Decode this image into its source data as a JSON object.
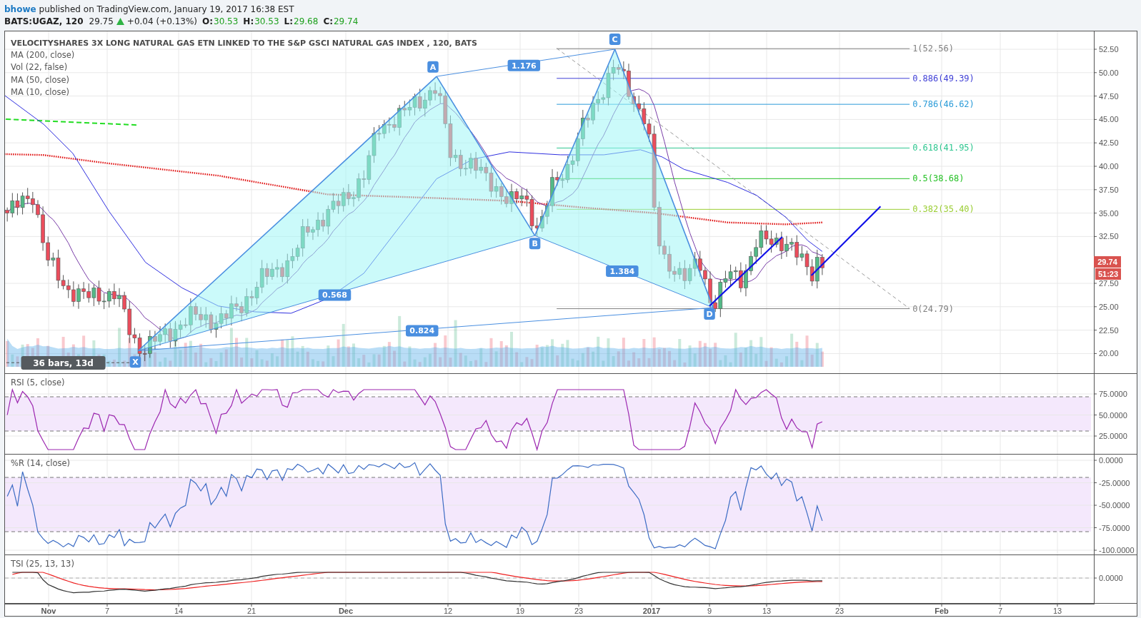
{
  "header": {
    "author": "bhowe",
    "published": "published on TradingView.com, January 19, 2017 16:38 EST"
  },
  "quote": {
    "symbol": "BATS:UGAZ, 120",
    "last": "29.75",
    "change": "+0.04 (+0.13%)",
    "ohlc": [
      {
        "label": "O:",
        "value": "30.53"
      },
      {
        "label": "H:",
        "value": "30.53"
      },
      {
        "label": "L:",
        "value": "29.68"
      },
      {
        "label": "C:",
        "value": "29.74"
      }
    ]
  },
  "price_pane": {
    "title": "VELOCITYSHARES 3X LONG NATURAL GAS ETN LINKED TO THE S&P GSCI NATURAL GAS INDEX , 120, BATS",
    "studies": [
      "MA (200, close)",
      "Vol (22, false)",
      "MA (50, close)",
      "MA (10, close)"
    ],
    "axis_labels": [
      "52.50",
      "50.00",
      "47.50",
      "45.00",
      "42.50",
      "40.00",
      "37.50",
      "35.00",
      "32.50",
      "27.50",
      "25.00",
      "22.50",
      "20.00"
    ],
    "fib_levels": [
      {
        "label": "1(52.56)",
        "color": "#808080"
      },
      {
        "label": "0.886(49.39)",
        "color": "#3f3fd6"
      },
      {
        "label": "0.786(46.62)",
        "color": "#2a9bd8"
      },
      {
        "label": "0.618(41.95)",
        "color": "#2ec68f"
      },
      {
        "label": "0.5(38.68)",
        "color": "#24c024"
      },
      {
        "label": "0.382(35.40)",
        "color": "#9acd32"
      },
      {
        "label": "0(24.79)",
        "color": "#808080"
      }
    ],
    "pattern_points": [
      "X",
      "A",
      "B",
      "C",
      "D"
    ],
    "ratios": [
      "1.176",
      "0.568",
      "1.384",
      "0.824"
    ],
    "range_label": "36 bars, 13d",
    "price_tag": "29.74",
    "countdown": "51:23"
  },
  "rsi_pane": {
    "title": "RSI (5, close)",
    "axis_labels": [
      "75.0000",
      "50.0000",
      "25.0000"
    ]
  },
  "r_pane": {
    "title": "%R (14, close)",
    "axis_labels": [
      "0.0000",
      "-25.0000",
      "-50.0000",
      "-75.0000",
      "-100.0000"
    ]
  },
  "tsi_pane": {
    "title": "TSI (25, 13, 13)",
    "axis_labels": [
      "0.0000"
    ]
  },
  "time_axis": [
    {
      "label": "Nov",
      "kind": "major"
    },
    {
      "label": "7",
      "kind": "minor"
    },
    {
      "label": "14",
      "kind": "minor"
    },
    {
      "label": "21",
      "kind": "minor"
    },
    {
      "label": "Dec",
      "kind": "major"
    },
    {
      "label": "12",
      "kind": "minor"
    },
    {
      "label": "19",
      "kind": "minor"
    },
    {
      "label": "23",
      "kind": "minor"
    },
    {
      "label": "2017",
      "kind": "major"
    },
    {
      "label": "9",
      "kind": "minor"
    },
    {
      "label": "13",
      "kind": "minor"
    },
    {
      "label": "23",
      "kind": "minor"
    },
    {
      "label": "Feb",
      "kind": "major"
    },
    {
      "label": "7",
      "kind": "minor"
    },
    {
      "label": "13",
      "kind": "minor"
    }
  ]
}
